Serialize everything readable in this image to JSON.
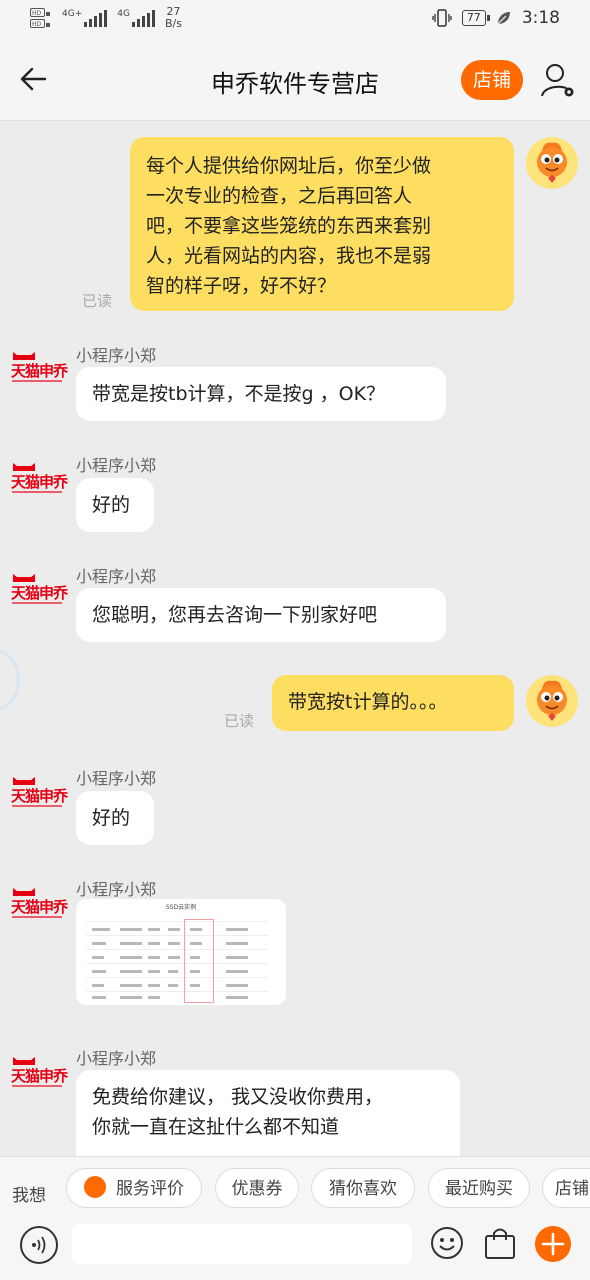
{
  "status_bar": {
    "speed_value": "27",
    "speed_unit": "B/s",
    "network_label": "4G+",
    "network_label2": "4G",
    "battery": "77",
    "time": "3:18"
  },
  "header": {
    "title": "申乔软件专营店",
    "shop_button": "店铺"
  },
  "messages": {
    "m1": {
      "lines": [
        "每个人提供给你网址后，你至少做",
        "一次专业的检查，之后再回答人",
        "吧，不要拿这些笼统的东西来套别",
        "人，光看网站的内容，我也不是弱",
        "智的样子呀，好不好？"
      ],
      "read": "已读"
    },
    "m2": {
      "sender": "小程序小郑",
      "text": "带宽是按tb计算，不是按g ，OK？"
    },
    "m3": {
      "sender": "小程序小郑",
      "text": "好的"
    },
    "m4": {
      "sender": "小程序小郑",
      "text": "您聪明，您再去咨询一下别家好吧"
    },
    "m5": {
      "text": "带宽按t计算的。。。",
      "read": "已读"
    },
    "m6": {
      "sender": "小程序小郑",
      "text": "好的"
    },
    "m7": {
      "sender": "小程序小郑",
      "image_title": "SSD云实例"
    },
    "m8": {
      "sender": "小程序小郑",
      "lines": [
        "免费给你建议， 我又没收你费用，",
        "你就一直在这扯什么都不知道"
      ]
    }
  },
  "store_logo": "天猫申乔",
  "quick_bar": {
    "label": "我想",
    "chips": [
      "服务评价",
      "优惠券",
      "猜你喜欢",
      "最近购买",
      "店铺"
    ]
  },
  "input_bar": {
    "value": ""
  },
  "colors": {
    "accent": "#ff6a00",
    "self_bubble": "#fdde60",
    "tmall_red": "#e60012"
  }
}
